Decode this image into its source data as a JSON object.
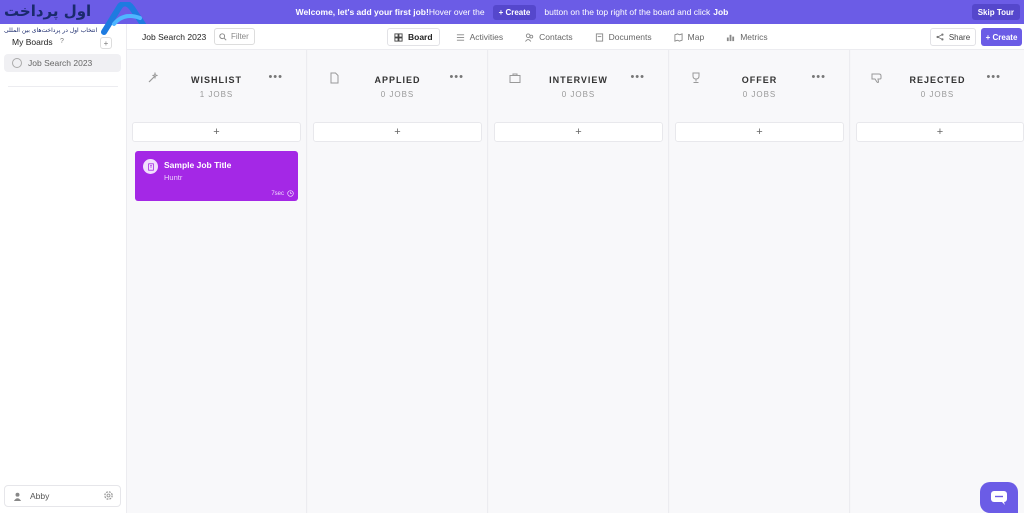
{
  "banner": {
    "welcome": "Welcome, let's add your first job!",
    "hover": "Hover over the",
    "create_pill": "+ Create",
    "rest": "button on the top right of the board and click",
    "job": "Job",
    "skip": "Skip Tour"
  },
  "logo": {
    "text": "اول پرداخت",
    "tagline": "انتخاب اول در پرداخت‌های بین المللی"
  },
  "sidebar": {
    "heading": "My Boards",
    "help": "?",
    "add": "+",
    "boards": [
      {
        "label": "Job Search 2023"
      }
    ],
    "user": {
      "name": "Abby"
    }
  },
  "toolbar": {
    "board_title": "Job Search 2023",
    "filter_placeholder": "Filter",
    "tabs": [
      {
        "label": "Board",
        "icon": "grid-icon",
        "active": true
      },
      {
        "label": "Activities",
        "icon": "list-icon"
      },
      {
        "label": "Contacts",
        "icon": "contacts-icon"
      },
      {
        "label": "Documents",
        "icon": "documents-icon"
      },
      {
        "label": "Map",
        "icon": "map-icon"
      },
      {
        "label": "Metrics",
        "icon": "bar-chart-icon"
      }
    ],
    "share": "Share",
    "create": "+ Create"
  },
  "columns": [
    {
      "name": "WISHLIST",
      "count": "1 JOBS",
      "icon": "wand-icon",
      "more": "•••",
      "add": "+"
    },
    {
      "name": "APPLIED",
      "count": "0 JOBS",
      "icon": "file-icon",
      "more": "•••",
      "add": "+"
    },
    {
      "name": "INTERVIEW",
      "count": "0 JOBS",
      "icon": "briefcase-icon",
      "more": "•••",
      "add": "+"
    },
    {
      "name": "OFFER",
      "count": "0 JOBS",
      "icon": "trophy-icon",
      "more": "•••",
      "add": "+"
    },
    {
      "name": "REJECTED",
      "count": "0 JOBS",
      "icon": "thumbs-down-icon",
      "more": "•••",
      "add": "+"
    }
  ],
  "card": {
    "title": "Sample Job Title",
    "company": "Huntr",
    "time": "7sec"
  },
  "colors": {
    "accent": "#6b5ce6",
    "card": "#a428e6"
  }
}
